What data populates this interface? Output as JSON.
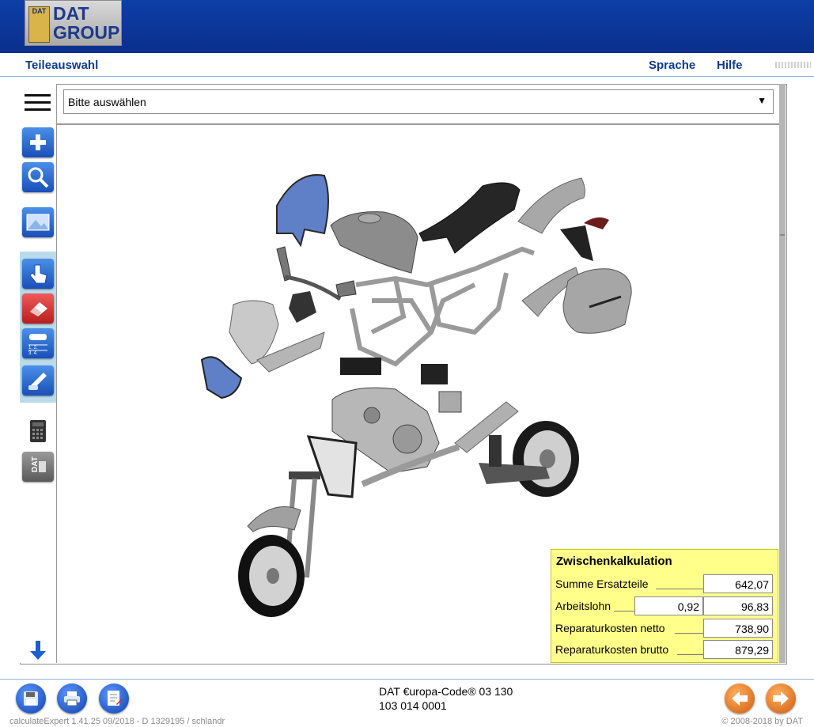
{
  "header": {
    "logo_badge": "DAT",
    "logo_line1": "DAT",
    "logo_line2": "GROUP"
  },
  "nav": {
    "title": "Teileauswahl",
    "language": "Sprache",
    "help": "Hilfe"
  },
  "sidebar": {
    "icons": [
      "menu-icon",
      "add-icon",
      "search-icon",
      "image-icon",
      "hand-pointer-icon",
      "eraser-icon",
      "car-list-icon",
      "car-repair-icon",
      "calculator-icon",
      "dat-paint-icon",
      "arrow-down-icon"
    ]
  },
  "selector": {
    "value": "Bitte auswählen",
    "arrow": "▼"
  },
  "calc": {
    "title": "Zwischenkalkulation",
    "rows": [
      {
        "label": "Summe Ersatzteile",
        "value": "642,07"
      },
      {
        "label": "Arbeitslohn",
        "factor": "0,92",
        "value": "96,83"
      },
      {
        "label": "Reparaturkosten netto",
        "value": "738,90"
      },
      {
        "label": "Reparaturkosten brutto",
        "value": "879,29"
      }
    ]
  },
  "footer": {
    "code_line1": "DAT €uropa-Code® 03 130",
    "code_line2": "103 014 0001",
    "version": "calculateExpert    1.41.25    09/2018 - D    1329195 / schlandr",
    "copyright": "© 2008-2018 by DAT"
  },
  "colors": {
    "header": "#0a2f8c",
    "accent": "#0c3a8c",
    "calc_bg": "#ffff8a",
    "nav_orange": "#e87a20"
  }
}
